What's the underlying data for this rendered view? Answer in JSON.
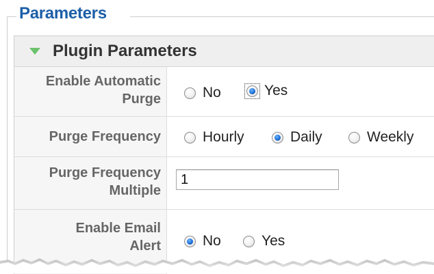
{
  "fieldset": {
    "legend": "Parameters"
  },
  "panel": {
    "title": "Plugin Parameters",
    "toggle_icon": "triangle-down-icon"
  },
  "rows": [
    {
      "label_line1": "Enable Automatic",
      "label_line2": "Purge",
      "options": [
        {
          "label": "No",
          "checked": false
        },
        {
          "label": "Yes",
          "checked": true
        }
      ]
    },
    {
      "label_line1": "Purge Frequency",
      "options": [
        {
          "label": "Hourly",
          "checked": false
        },
        {
          "label": "Daily",
          "checked": true
        },
        {
          "label": "Weekly",
          "checked": false
        }
      ]
    },
    {
      "label_line1": "Purge Frequency",
      "label_line2": "Multiple",
      "input_value": "1"
    },
    {
      "label_line1": "Enable Email",
      "label_line2": "Alert",
      "options": [
        {
          "label": "No",
          "checked": true
        },
        {
          "label": "Yes",
          "checked": false
        }
      ]
    }
  ],
  "colors": {
    "legend": "#1d5fa8",
    "toggle_icon": "#6cc16c",
    "radio_selected": "#1c6fd6"
  }
}
